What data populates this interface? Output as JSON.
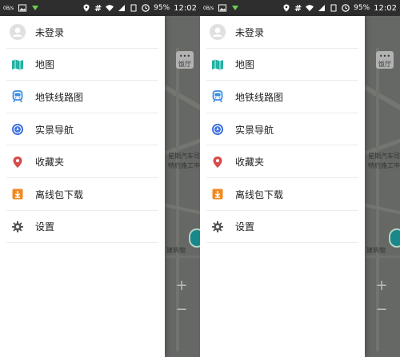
{
  "status_bar": {
    "battery_percent": "95%",
    "time": "12:02",
    "network_label": "#",
    "small_label": "0B/s"
  },
  "drawer": {
    "items": [
      {
        "key": "user",
        "label": "未登录",
        "icon": "user-avatar-icon",
        "color": "#d5d5d5"
      },
      {
        "key": "map",
        "label": "地图",
        "icon": "map-icon",
        "color": "#20b2a4"
      },
      {
        "key": "subway",
        "label": "地铁线路图",
        "icon": "subway-icon",
        "color": "#3d8fe0"
      },
      {
        "key": "nav",
        "label": "实景导航",
        "icon": "navigation-icon",
        "color": "#3a6de0"
      },
      {
        "key": "fav",
        "label": "收藏夹",
        "icon": "location-pin-icon",
        "color": "#d84a4a"
      },
      {
        "key": "offline",
        "label": "离线包下载",
        "icon": "download-icon",
        "color": "#f08a24"
      },
      {
        "key": "settings",
        "label": "设置",
        "icon": "gear-icon",
        "color": "#555555"
      }
    ]
  },
  "map": {
    "texts": [
      "饭厅",
      "星期汽车司",
      "特约施工中",
      "建筑物",
      "+",
      "−"
    ]
  }
}
